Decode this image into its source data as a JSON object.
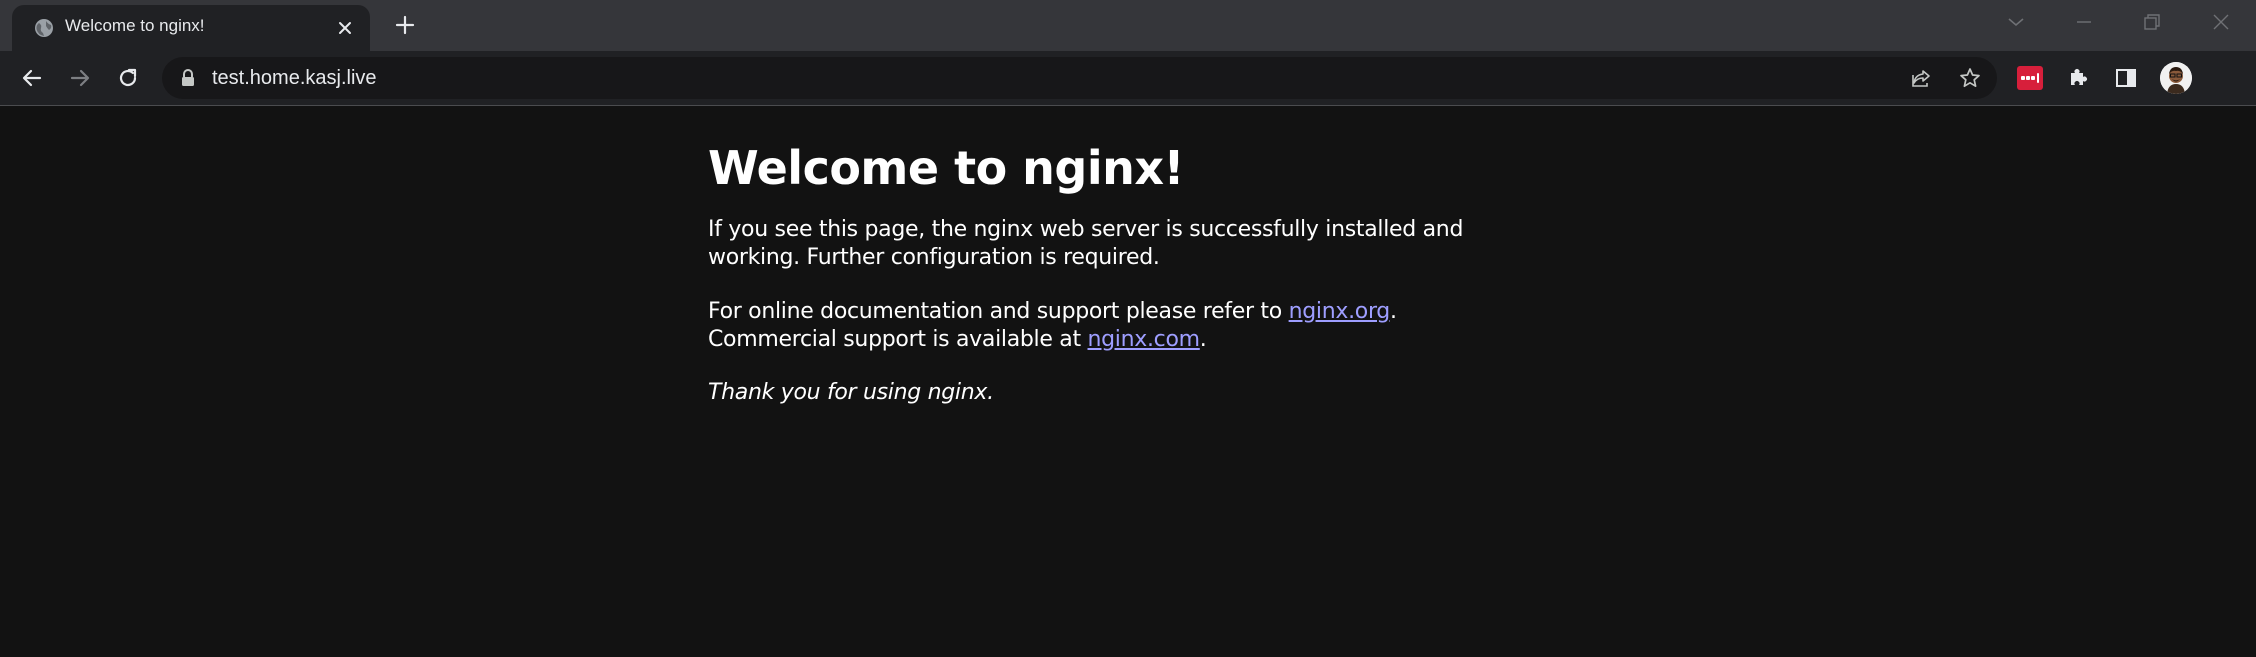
{
  "tab": {
    "title": "Welcome to nginx!"
  },
  "address_bar": {
    "url": "test.home.kasj.live"
  },
  "icons": {
    "favicon": "globe-icon",
    "tab_close": "close-icon",
    "new_tab": "plus-icon",
    "back": "arrow-left-icon",
    "forward": "arrow-right-icon",
    "reload": "reload-icon",
    "lock": "lock-icon",
    "share": "share-icon",
    "bookmark": "star-icon",
    "extension": "lastpass-icon",
    "extensions": "puzzle-icon",
    "side_panel": "side-panel-icon",
    "profile": "avatar",
    "tab_search": "chevron-down-icon",
    "minimize": "minimize-icon",
    "restore": "restore-icon",
    "close_window": "close-window-icon"
  },
  "page": {
    "heading": "Welcome to nginx!",
    "para1": "If you see this page, the nginx web server is successfully installed and working. Further configuration is required.",
    "para2_prefix": "For online documentation and support please refer to ",
    "link_org": "nginx.org",
    "para2_mid": ".",
    "para2_line2": "Commercial support is available at ",
    "link_com": "nginx.com",
    "para2_suffix": ".",
    "para3": "Thank you for using nginx."
  },
  "colors": {
    "page_background": "#121212",
    "link": "#9e9eff",
    "extension_red": "#d71f3b"
  }
}
